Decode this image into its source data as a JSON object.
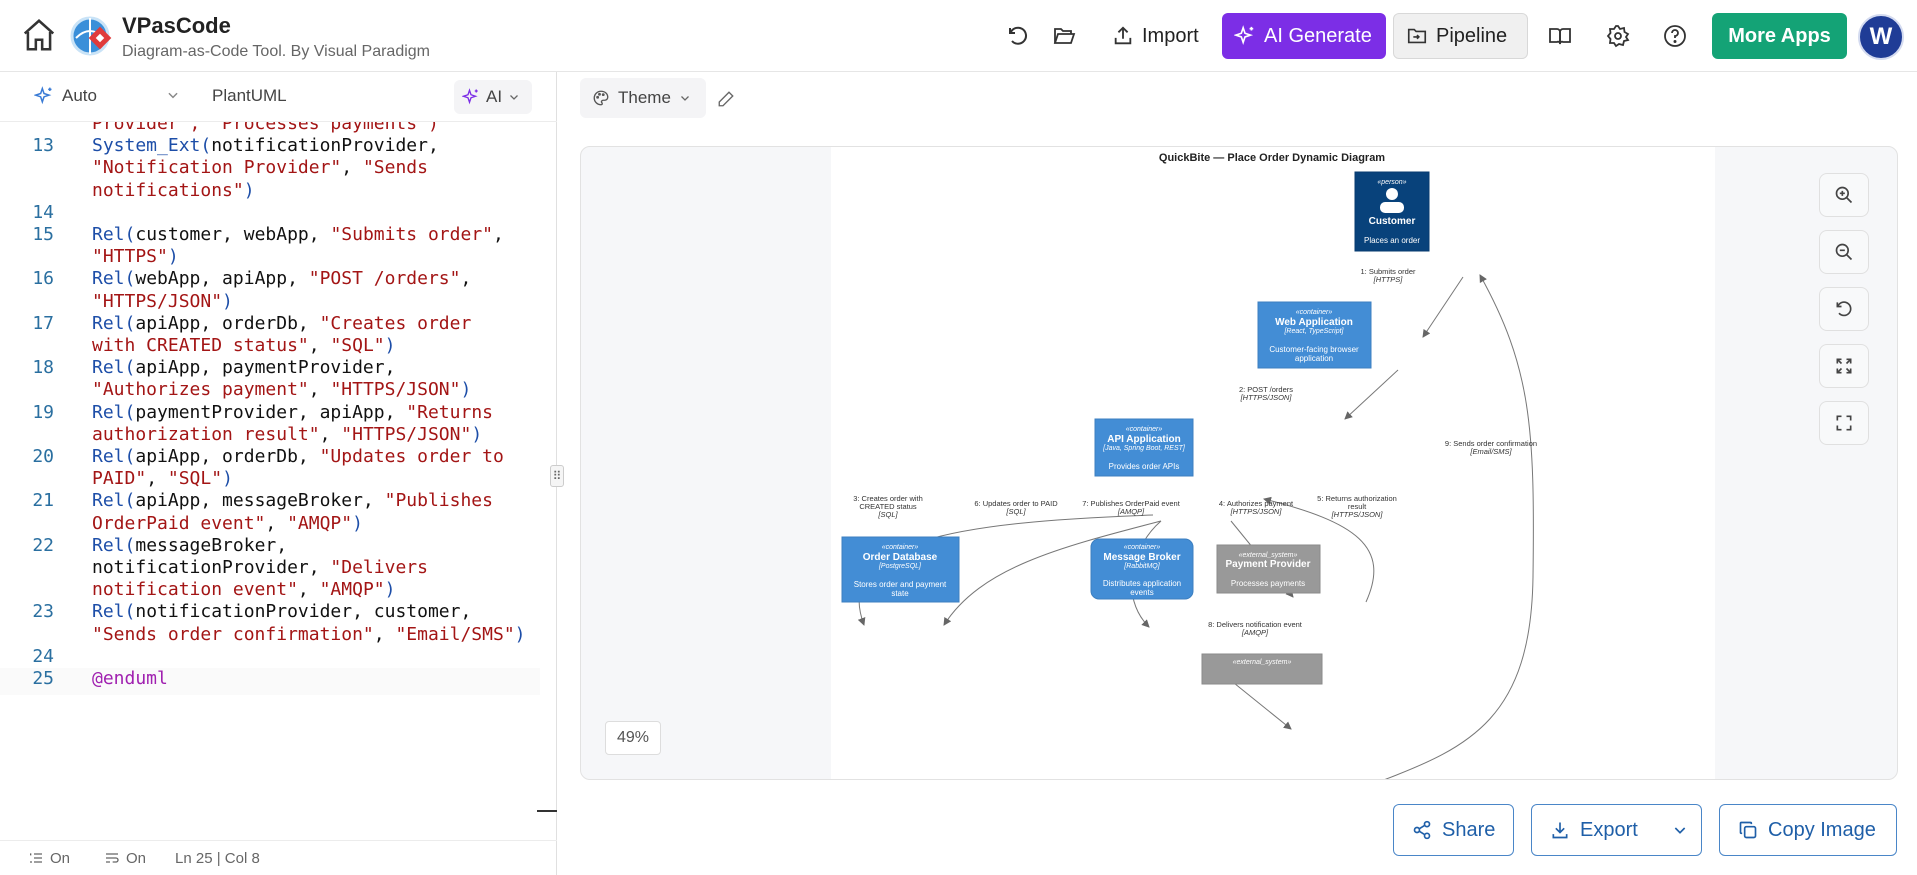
{
  "header": {
    "title": "VPasCode",
    "subtitle": "Diagram-as-Code Tool. By Visual Paradigm",
    "import_label": "Import",
    "ai_generate_label": "AI Generate",
    "pipeline_label": "Pipeline",
    "more_apps_label": "More Apps",
    "avatar_initial": "W",
    "accent_purple": "#7c2ee6",
    "accent_green": "#14a376"
  },
  "editor": {
    "mode_label": "Auto",
    "language_label": "PlantUML",
    "ai_label": "AI",
    "status": {
      "wrap_label": "On",
      "minimap_label": "On",
      "position": "Ln 25 | Col 8"
    }
  },
  "canvas": {
    "theme_label": "Theme",
    "zoom_level": "49%"
  },
  "diagram": {
    "title": "QuickBite — Place Order Dynamic Diagram",
    "customer": {
      "stereo": "«person»",
      "name": "Customer",
      "desc": "Places an order"
    },
    "web": {
      "stereo": "«container»",
      "name": "Web Application",
      "tech": "[React, TypeScript]",
      "desc1": "Customer-facing browser",
      "desc2": "application"
    },
    "api": {
      "stereo": "«container»",
      "name": "API Application",
      "tech": "[Java, Spring Boot, REST]",
      "desc": "Provides order APIs"
    },
    "db": {
      "stereo": "«container»",
      "name": "Order Database",
      "tech": "[PostgreSQL]",
      "desc1": "Stores order and payment",
      "desc2": "state"
    },
    "broker": {
      "stereo": "«container»",
      "name": "Message Broker",
      "tech": "[RabbitMQ]",
      "desc1": "Distributes application",
      "desc2": "events"
    },
    "payment": {
      "stereo": "«external_system»",
      "name": "Payment Provider",
      "desc": "Processes payments"
    },
    "notif_stereo": "«external_system»",
    "rel1": "1: Submits order",
    "rel1t": "[HTTPS]",
    "rel2": "2: POST /orders",
    "rel2t": "[HTTPS/JSON]",
    "rel3a": "3: Creates order with",
    "rel3b": "CREATED status",
    "rel3t": "[SQL]",
    "rel4": "4: Authorizes payment",
    "rel4t": "[HTTPS/JSON]",
    "rel5a": "5: Returns authorization",
    "rel5b": "result",
    "rel5t": "[HTTPS/JSON]",
    "rel6": "6: Updates order to PAID",
    "rel6t": "[SQL]",
    "rel7": "7: Publishes OrderPaid event",
    "rel7t": "[AMQP]",
    "rel8": "8: Delivers notification event",
    "rel8t": "[AMQP]",
    "rel9": "9: Sends order confirmation",
    "rel9t": "[Email/SMS]",
    "container_color": "#438dd5",
    "person_color": "#08427b",
    "external_color": "#999999"
  },
  "bottom": {
    "share_label": "Share",
    "export_label": "Export",
    "copy_label": "Copy Image"
  },
  "code_lines": [
    {
      "n": "",
      "parts": [
        [
          "str",
          "Provider\", \"Processes payments\")"
        ]
      ]
    },
    {
      "n": "13",
      "parts": [
        [
          "kw",
          "System_Ext"
        ],
        [
          "pl",
          "("
        ],
        [
          "id",
          "notificationProvider,"
        ]
      ]
    },
    {
      "n": "",
      "parts": [
        [
          "str",
          "\"Notification Provider\""
        ],
        [
          "id",
          ", "
        ],
        [
          "str",
          "\"Sends"
        ]
      ]
    },
    {
      "n": "",
      "parts": [
        [
          "str",
          "notifications\""
        ],
        [
          "pl",
          ")"
        ]
      ]
    },
    {
      "n": "14",
      "parts": []
    },
    {
      "n": "15",
      "parts": [
        [
          "kw",
          "Rel"
        ],
        [
          "pl",
          "("
        ],
        [
          "id",
          "customer, webApp, "
        ],
        [
          "str",
          "\"Submits order\""
        ],
        [
          "id",
          ","
        ]
      ]
    },
    {
      "n": "",
      "parts": [
        [
          "str",
          "\"HTTPS\""
        ],
        [
          "pl",
          ")"
        ]
      ]
    },
    {
      "n": "16",
      "parts": [
        [
          "kw",
          "Rel"
        ],
        [
          "pl",
          "("
        ],
        [
          "id",
          "webApp, apiApp, "
        ],
        [
          "str",
          "\"POST /orders\""
        ],
        [
          "id",
          ","
        ]
      ]
    },
    {
      "n": "",
      "parts": [
        [
          "str",
          "\"HTTPS/JSON\""
        ],
        [
          "pl",
          ")"
        ]
      ]
    },
    {
      "n": "17",
      "parts": [
        [
          "kw",
          "Rel"
        ],
        [
          "pl",
          "("
        ],
        [
          "id",
          "apiApp, orderDb, "
        ],
        [
          "str",
          "\"Creates order"
        ]
      ]
    },
    {
      "n": "",
      "parts": [
        [
          "str",
          "with CREATED status\""
        ],
        [
          "id",
          ", "
        ],
        [
          "str",
          "\"SQL\""
        ],
        [
          "pl",
          ")"
        ]
      ]
    },
    {
      "n": "18",
      "parts": [
        [
          "kw",
          "Rel"
        ],
        [
          "pl",
          "("
        ],
        [
          "id",
          "apiApp, paymentProvider,"
        ]
      ]
    },
    {
      "n": "",
      "parts": [
        [
          "str",
          "\"Authorizes payment\""
        ],
        [
          "id",
          ", "
        ],
        [
          "str",
          "\"HTTPS/JSON\""
        ],
        [
          "pl",
          ")"
        ]
      ]
    },
    {
      "n": "19",
      "parts": [
        [
          "kw",
          "Rel"
        ],
        [
          "pl",
          "("
        ],
        [
          "id",
          "paymentProvider, apiApp, "
        ],
        [
          "str",
          "\"Returns"
        ]
      ]
    },
    {
      "n": "",
      "parts": [
        [
          "str",
          "authorization result\""
        ],
        [
          "id",
          ", "
        ],
        [
          "str",
          "\"HTTPS/JSON\""
        ],
        [
          "pl",
          ")"
        ]
      ]
    },
    {
      "n": "20",
      "parts": [
        [
          "kw",
          "Rel"
        ],
        [
          "pl",
          "("
        ],
        [
          "id",
          "apiApp, orderDb, "
        ],
        [
          "str",
          "\"Updates order to"
        ]
      ]
    },
    {
      "n": "",
      "parts": [
        [
          "str",
          "PAID\""
        ],
        [
          "id",
          ", "
        ],
        [
          "str",
          "\"SQL\""
        ],
        [
          "pl",
          ")"
        ]
      ]
    },
    {
      "n": "21",
      "parts": [
        [
          "kw",
          "Rel"
        ],
        [
          "pl",
          "("
        ],
        [
          "id",
          "apiApp, messageBroker, "
        ],
        [
          "str",
          "\"Publishes"
        ]
      ]
    },
    {
      "n": "",
      "parts": [
        [
          "str",
          "OrderPaid event\""
        ],
        [
          "id",
          ", "
        ],
        [
          "str",
          "\"AMQP\""
        ],
        [
          "pl",
          ")"
        ]
      ]
    },
    {
      "n": "22",
      "parts": [
        [
          "kw",
          "Rel"
        ],
        [
          "pl",
          "("
        ],
        [
          "id",
          "messageBroker,"
        ]
      ]
    },
    {
      "n": "",
      "parts": [
        [
          "id",
          "notificationProvider, "
        ],
        [
          "str",
          "\"Delivers"
        ]
      ]
    },
    {
      "n": "",
      "parts": [
        [
          "str",
          "notification event\""
        ],
        [
          "id",
          ", "
        ],
        [
          "str",
          "\"AMQP\""
        ],
        [
          "pl",
          ")"
        ]
      ]
    },
    {
      "n": "23",
      "parts": [
        [
          "kw",
          "Rel"
        ],
        [
          "pl",
          "("
        ],
        [
          "id",
          "notificationProvider, customer,"
        ]
      ]
    },
    {
      "n": "",
      "parts": [
        [
          "str",
          "\"Sends order confirmation\""
        ],
        [
          "id",
          ", "
        ],
        [
          "str",
          "\"Email/SMS\""
        ],
        [
          "pl",
          ")"
        ]
      ]
    },
    {
      "n": "24",
      "parts": []
    },
    {
      "n": "25",
      "parts": [
        [
          "en",
          "@enduml"
        ]
      ]
    }
  ]
}
